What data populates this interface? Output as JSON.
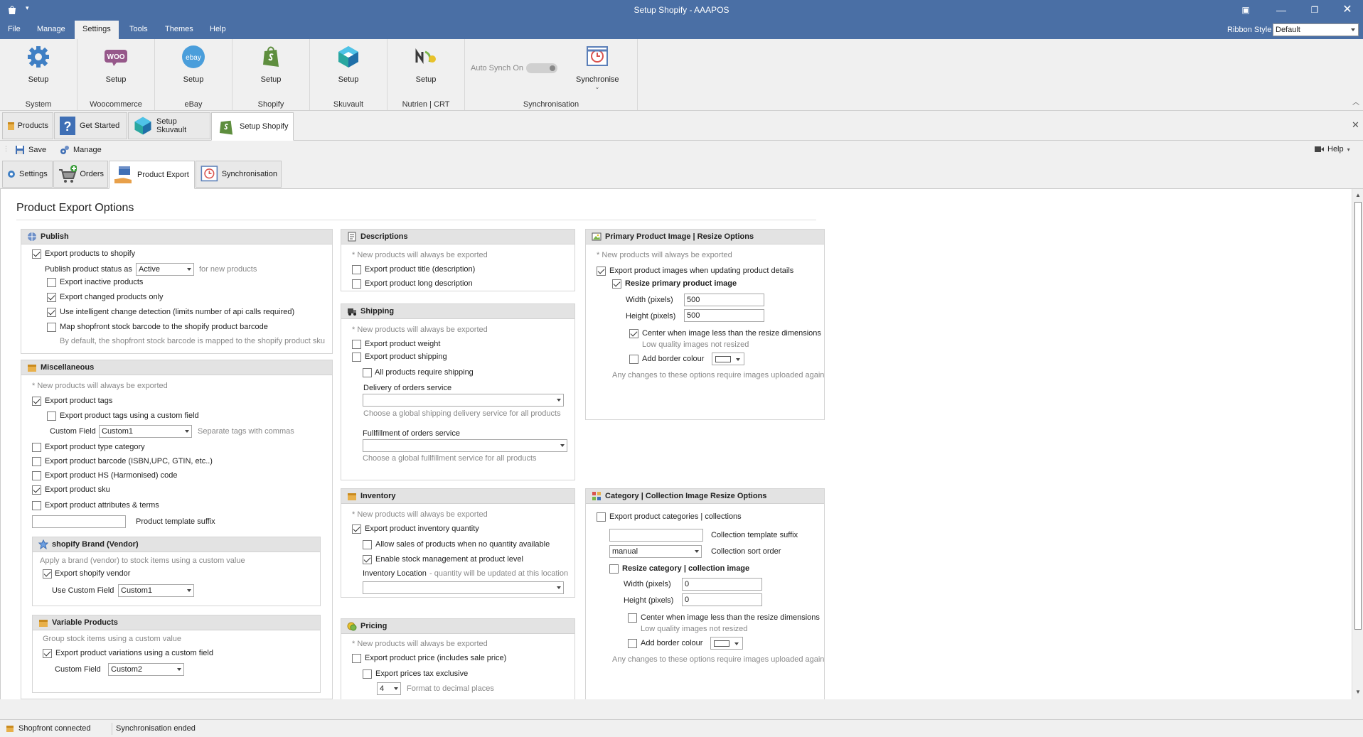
{
  "window": {
    "title": "Setup Shopify - AAAPOS"
  },
  "menu": [
    "File",
    "Manage",
    "Settings",
    "Tools",
    "Themes",
    "Help"
  ],
  "ribbon_style": {
    "label": "Ribbon Style",
    "value": "Default"
  },
  "ribbon": {
    "groups": [
      {
        "button": "Setup",
        "label": "System"
      },
      {
        "button": "Setup",
        "label": "Woocommerce"
      },
      {
        "button": "Setup",
        "label": "eBay"
      },
      {
        "button": "Setup",
        "label": "Shopify"
      },
      {
        "button": "Setup",
        "label": "Skuvault"
      },
      {
        "button": "Setup",
        "label": "Nutrien | CRT"
      }
    ],
    "sync": {
      "toggle_label": "Auto Synch On",
      "button": "Synchronise",
      "label": "Synchronisation"
    },
    "icons": {
      "woo_text": "WOO",
      "ebay_text": "ebay"
    }
  },
  "doc_tabs": [
    "Products",
    "Get Started",
    "Setup Skuvault",
    "Setup Shopify"
  ],
  "toolbar": {
    "save": "Save",
    "manage": "Manage",
    "help": "Help"
  },
  "sub_tabs": [
    "Settings",
    "Orders",
    "Product Export",
    "Synchronisation"
  ],
  "page_title": "Product Export Options",
  "publish": {
    "title": "Publish",
    "export": "Export products to shopify",
    "status_label": "Publish product status as",
    "status_value": "Active",
    "status_hint": "for new products",
    "inactive": "Export inactive products",
    "changed": "Export changed products only",
    "intelligent": "Use intelligent change detection (limits number of api calls required)",
    "barcode": "Map shopfront stock barcode to the shopify product barcode",
    "barcode_hint": "By default, the shopfront stock barcode is mapped to the shopify product sku"
  },
  "misc": {
    "title": "Miscellaneous",
    "note": "* New products will always be exported",
    "tags": "Export product tags",
    "tags_custom": "Export product tags using a custom field",
    "custom_field_label": "Custom Field",
    "custom_field_value": "Custom1",
    "custom_field_hint": "Separate tags with commas",
    "type_category": "Export product type category",
    "barcode": "Export product barcode (ISBN,UPC, GTIN, etc..)",
    "hs_code": "Export product HS (Harmonised) code",
    "sku": "Export product sku",
    "attributes": "Export product attributes & terms",
    "template_suffix_label": "Product template suffix",
    "template_suffix_value": ""
  },
  "brand": {
    "title": "shopify Brand (Vendor)",
    "hint": "Apply a brand (vendor) to stock items using a custom value",
    "export": "Export shopify vendor",
    "use_custom_label": "Use Custom Field",
    "use_custom_value": "Custom1"
  },
  "variable": {
    "title": "Variable Products",
    "hint": "Group stock items using a custom value",
    "export": "Export product variations using a custom field",
    "custom_field_label": "Custom Field",
    "custom_field_value": "Custom2"
  },
  "descriptions": {
    "title": "Descriptions",
    "note": "* New products will always be exported",
    "title_desc": "Export product title (description)",
    "long_desc": "Export product long description"
  },
  "shipping": {
    "title": "Shipping",
    "note": "* New products will always be exported",
    "weight": "Export product weight",
    "shipping": "Export product shipping",
    "require": "All products require shipping",
    "delivery_label": "Delivery of orders service",
    "delivery_value": "",
    "delivery_hint": "Choose a global shipping delivery service for all products",
    "fulfillment_label": "Fullfillment of orders service",
    "fulfillment_value": "",
    "fulfillment_hint": "Choose a global fullfillment service for all products"
  },
  "inventory": {
    "title": "Inventory",
    "note": "* New products will always be exported",
    "quantity": "Export product inventory quantity",
    "allow_sales": "Allow sales of products when no quantity available",
    "stock_mgmt": "Enable stock management at product level",
    "location_label": "Inventory Location",
    "location_hint": "- quantity will be updated at this location",
    "location_value": ""
  },
  "pricing": {
    "title": "Pricing",
    "note": "* New products will always be exported",
    "price": "Export product price (includes sale price)",
    "tax_excl": "Export prices tax exclusive",
    "decimals_value": "4",
    "decimals_label": "Format to decimal places"
  },
  "primary_image": {
    "title": "Primary Product Image | Resize Options",
    "note": "* New products will always be exported",
    "export": "Export product images when updating product details",
    "resize": "Resize primary product image",
    "width_label": "Width (pixels)",
    "width_value": "500",
    "height_label": "Height (pixels)",
    "height_value": "500",
    "center": "Center when image less than the resize dimensions",
    "center_hint": "Low quality images not resized",
    "border": "Add border colour",
    "footer": "Any changes to these options require images uploaded again"
  },
  "category_image": {
    "title": "Category | Collection Image Resize Options",
    "export": "Export product categories | collections",
    "suffix_label": "Collection template suffix",
    "suffix_value": "",
    "sort_value": "manual",
    "sort_label": "Collection sort order",
    "resize": "Resize category | collection image",
    "width_label": "Width (pixels)",
    "width_value": "0",
    "height_label": "Height (pixels)",
    "height_value": "0",
    "center": "Center when image less than the resize dimensions",
    "center_hint": "Low quality images not resized",
    "border": "Add border colour",
    "footer": "Any changes to these options require images uploaded again"
  },
  "status": {
    "connection": "Shopfront connected",
    "sync": "Synchronisation ended"
  },
  "colors": {
    "titlebar": "#4a6fa5",
    "ribbon": "#f0f0f0",
    "shopify_green": "#5e8e3e",
    "woo_purple": "#96588a",
    "ebay_blue": "#4a9edb"
  }
}
